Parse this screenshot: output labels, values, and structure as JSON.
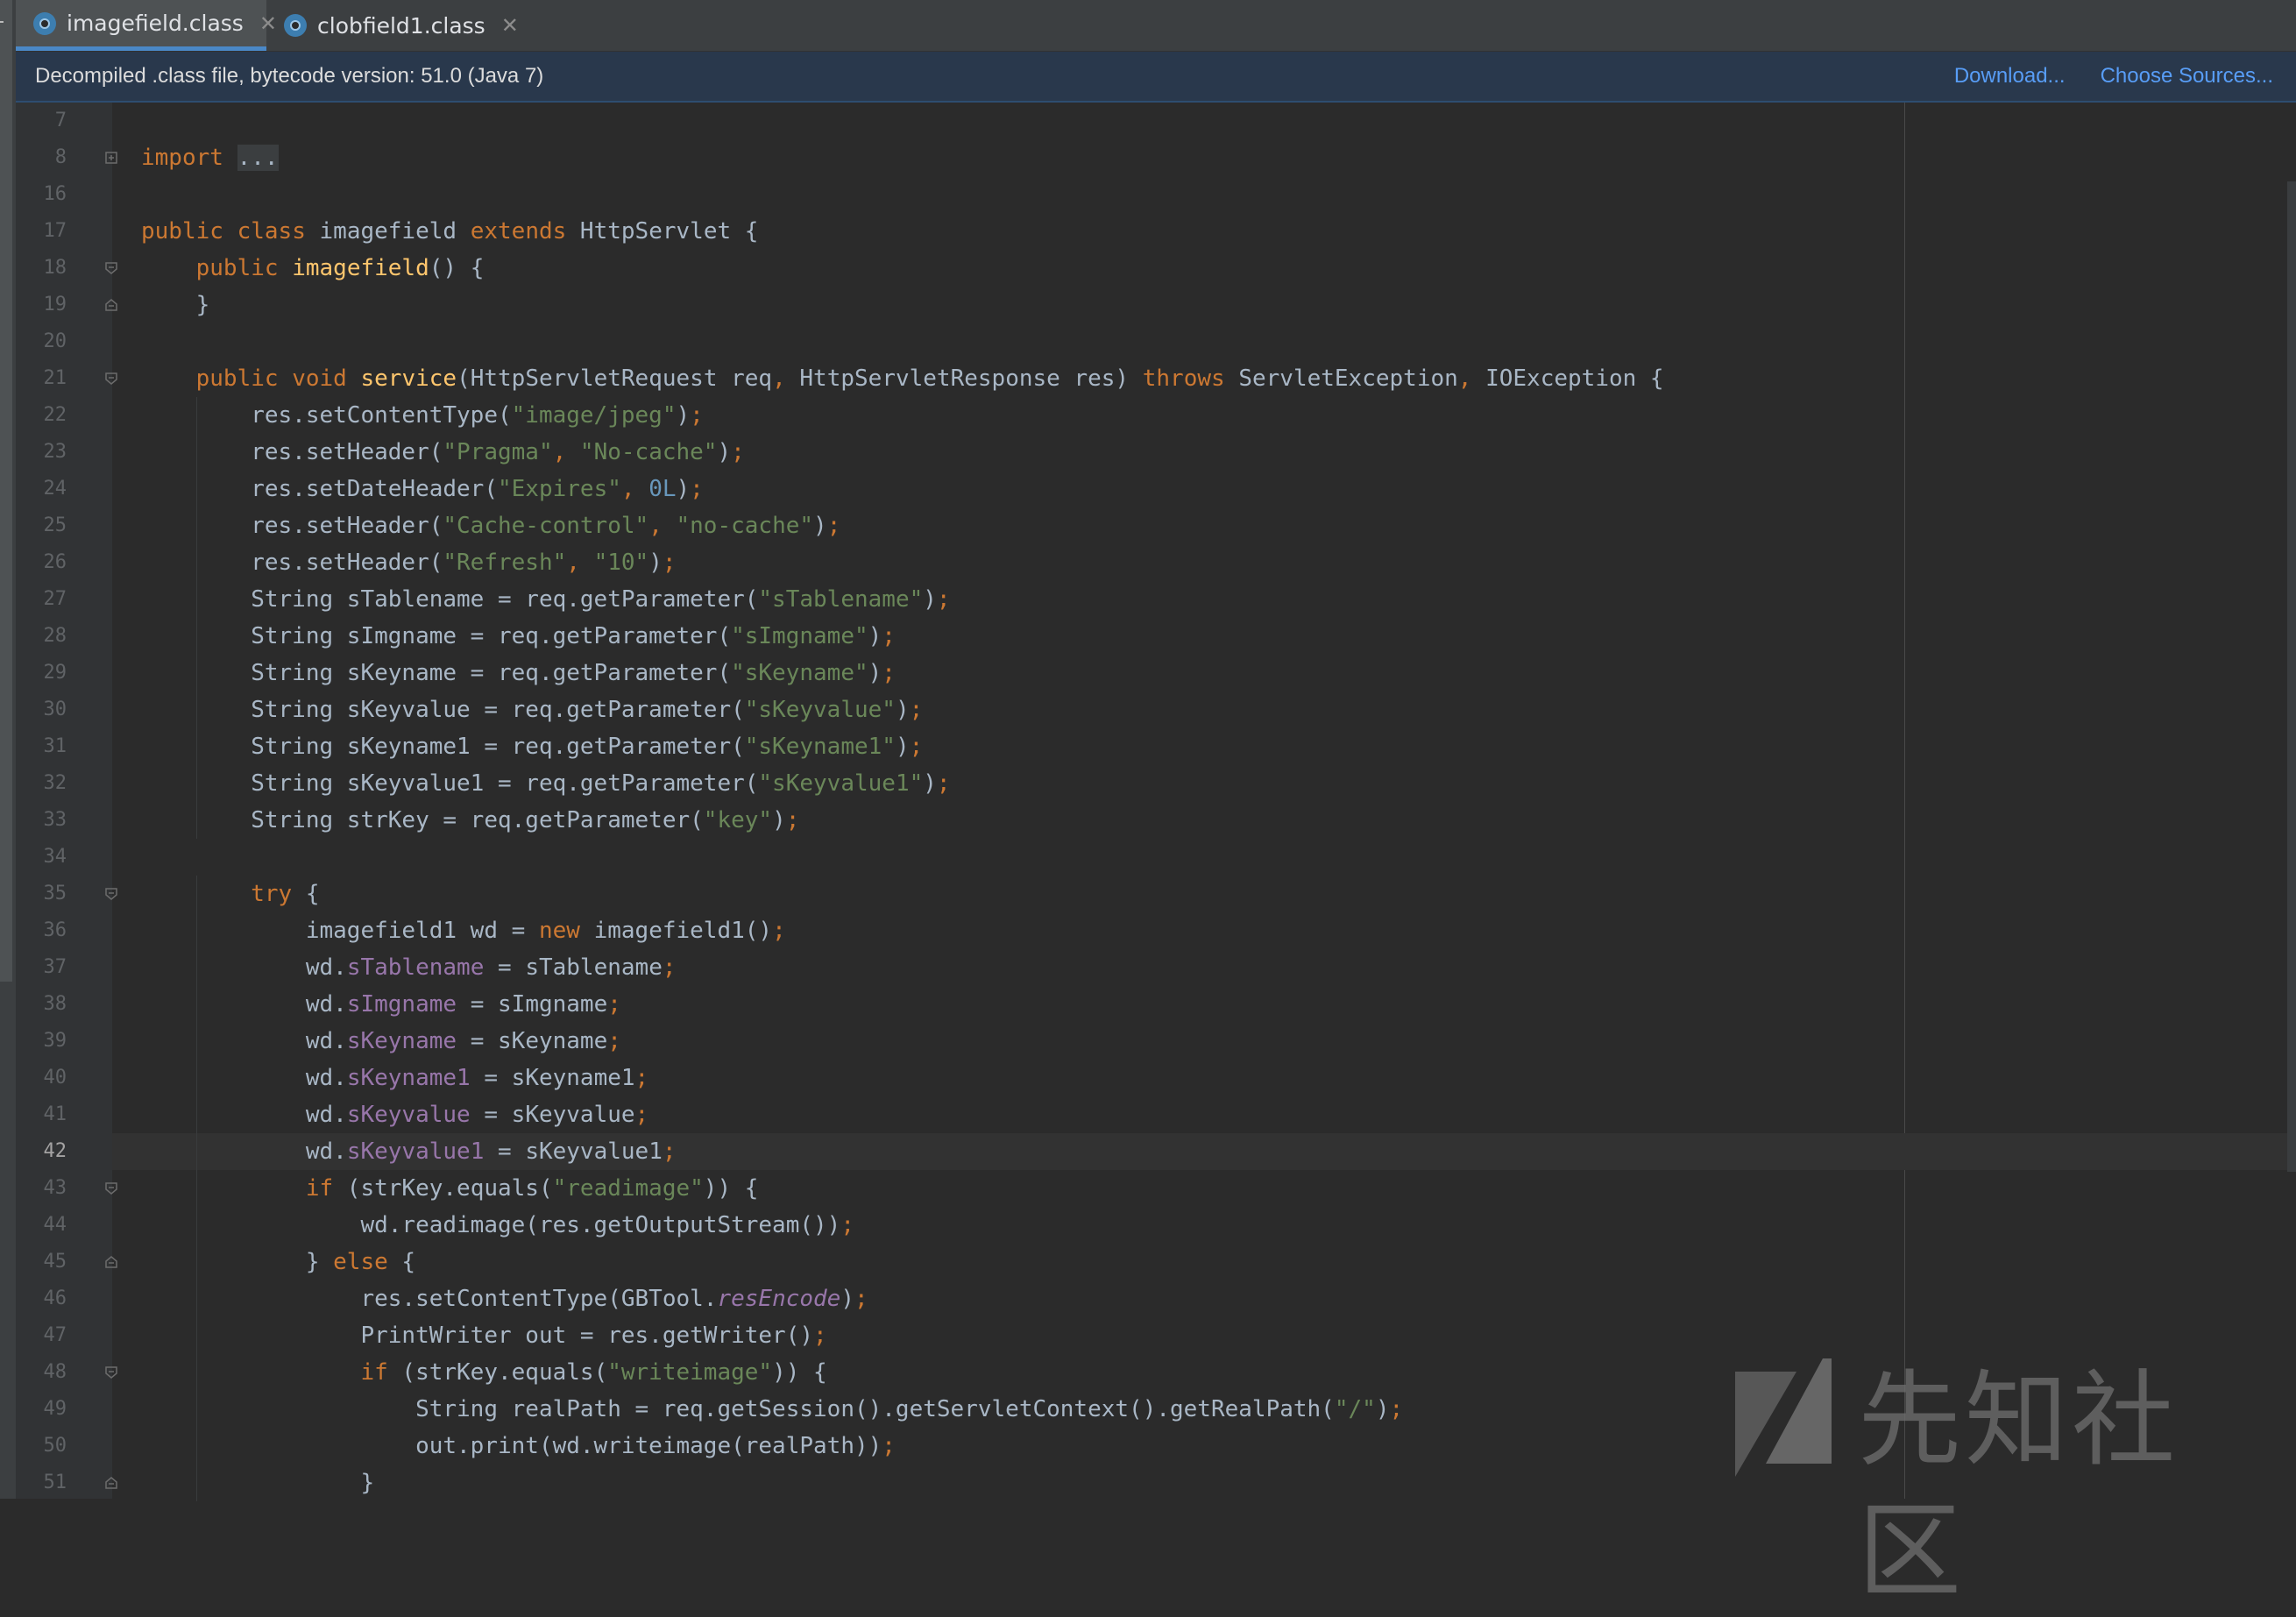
{
  "tabs": [
    {
      "label": "imagefield.class",
      "active": true
    },
    {
      "label": "clobfield1.class",
      "active": false
    }
  ],
  "infobar": {
    "message": "Decompiled .class file, bytecode version: 51.0 (Java 7)",
    "download_label": "Download...",
    "choose_sources_label": "Choose Sources..."
  },
  "editor": {
    "current_line": 42,
    "lines": [
      {
        "n": 7,
        "text": ""
      },
      {
        "n": 8,
        "text": "import ..."
      },
      {
        "n": 16,
        "text": ""
      },
      {
        "n": 17,
        "text": "public class imagefield extends HttpServlet {"
      },
      {
        "n": 18,
        "text": "    public imagefield() {"
      },
      {
        "n": 19,
        "text": "    }"
      },
      {
        "n": 20,
        "text": ""
      },
      {
        "n": 21,
        "text": "    public void service(HttpServletRequest req, HttpServletResponse res) throws ServletException, IOException {"
      },
      {
        "n": 22,
        "text": "        res.setContentType(\"image/jpeg\");"
      },
      {
        "n": 23,
        "text": "        res.setHeader(\"Pragma\", \"No-cache\");"
      },
      {
        "n": 24,
        "text": "        res.setDateHeader(\"Expires\", 0L);"
      },
      {
        "n": 25,
        "text": "        res.setHeader(\"Cache-control\", \"no-cache\");"
      },
      {
        "n": 26,
        "text": "        res.setHeader(\"Refresh\", \"10\");"
      },
      {
        "n": 27,
        "text": "        String sTablename = req.getParameter(\"sTablename\");"
      },
      {
        "n": 28,
        "text": "        String sImgname = req.getParameter(\"sImgname\");"
      },
      {
        "n": 29,
        "text": "        String sKeyname = req.getParameter(\"sKeyname\");"
      },
      {
        "n": 30,
        "text": "        String sKeyvalue = req.getParameter(\"sKeyvalue\");"
      },
      {
        "n": 31,
        "text": "        String sKeyname1 = req.getParameter(\"sKeyname1\");"
      },
      {
        "n": 32,
        "text": "        String sKeyvalue1 = req.getParameter(\"sKeyvalue1\");"
      },
      {
        "n": 33,
        "text": "        String strKey = req.getParameter(\"key\");"
      },
      {
        "n": 34,
        "text": ""
      },
      {
        "n": 35,
        "text": "        try {"
      },
      {
        "n": 36,
        "text": "            imagefield1 wd = new imagefield1();"
      },
      {
        "n": 37,
        "text": "            wd.sTablename = sTablename;"
      },
      {
        "n": 38,
        "text": "            wd.sImgname = sImgname;"
      },
      {
        "n": 39,
        "text": "            wd.sKeyname = sKeyname;"
      },
      {
        "n": 40,
        "text": "            wd.sKeyname1 = sKeyname1;"
      },
      {
        "n": 41,
        "text": "            wd.sKeyvalue = sKeyvalue;"
      },
      {
        "n": 42,
        "text": "            wd.sKeyvalue1 = sKeyvalue1;"
      },
      {
        "n": 43,
        "text": "            if (strKey.equals(\"readimage\")) {"
      },
      {
        "n": 44,
        "text": "                wd.readimage(res.getOutputStream());"
      },
      {
        "n": 45,
        "text": "            } else {"
      },
      {
        "n": 46,
        "text": "                res.setContentType(GBTool.resEncode);"
      },
      {
        "n": 47,
        "text": "                PrintWriter out = res.getWriter();"
      },
      {
        "n": 48,
        "text": "                if (strKey.equals(\"writeimage\")) {"
      },
      {
        "n": 49,
        "text": "                    String realPath = req.getSession().getServletContext().getRealPath(\"/\");"
      },
      {
        "n": 50,
        "text": "                    out.print(wd.writeimage(realPath));"
      },
      {
        "n": 51,
        "text": "                }"
      }
    ],
    "folds": {
      "8": "collapsed",
      "18": "open",
      "19": "end",
      "21": "open",
      "35": "open",
      "43": "open",
      "45": "end",
      "48": "open",
      "51": "end"
    },
    "watermark": "先知社区"
  },
  "colors": {
    "keyword": "#cc7832",
    "string": "#6a8759",
    "number": "#6897bb",
    "method_decl": "#ffc66d",
    "field": "#9876aa",
    "text": "#a9b7c6",
    "background": "#2b2b2b",
    "link": "#589df6"
  }
}
